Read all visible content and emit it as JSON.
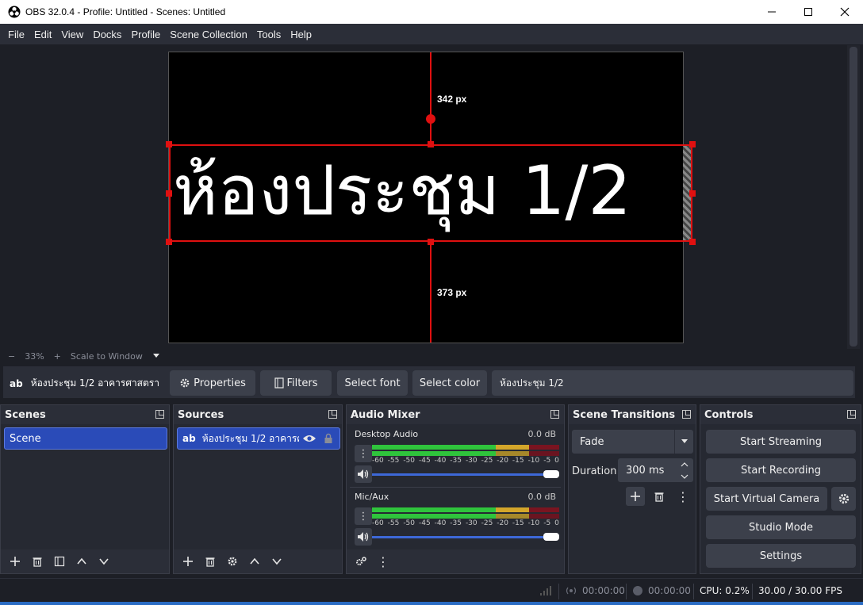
{
  "window": {
    "title": "OBS 32.0.4 - Profile: Untitled - Scenes: Untitled"
  },
  "menu": [
    "File",
    "Edit",
    "View",
    "Docks",
    "Profile",
    "Scene Collection",
    "Tools",
    "Help"
  ],
  "preview": {
    "text": "ห้องประชุม 1/2",
    "top_distance": "342 px",
    "bottom_distance": "373 px"
  },
  "zoom": {
    "minus": "−",
    "level": "33%",
    "plus": "+",
    "mode": "Scale to Window"
  },
  "source_toolbar": {
    "source_name": "ห้องประชุม 1/2 อาคารศาสตรา",
    "properties": "Properties",
    "filters": "Filters",
    "select_font": "Select font",
    "select_color": "Select color",
    "text_value": "ห้องประชุม 1/2"
  },
  "scenes": {
    "title": "Scenes",
    "items": [
      "Scene"
    ]
  },
  "sources": {
    "title": "Sources",
    "items": [
      "ห้องประชุม 1/2 อาคารศ"
    ]
  },
  "audio_mixer": {
    "title": "Audio Mixer",
    "ticks": [
      "-60",
      "-55",
      "-50",
      "-45",
      "-40",
      "-35",
      "-30",
      "-25",
      "-20",
      "-15",
      "-10",
      "-5",
      "0"
    ],
    "channels": [
      {
        "name": "Desktop Audio",
        "db": "0.0 dB",
        "volume": 1.0
      },
      {
        "name": "Mic/Aux",
        "db": "0.0 dB",
        "volume": 1.0
      }
    ]
  },
  "transitions": {
    "title": "Scene Transitions",
    "selected": "Fade",
    "duration_label": "Duration",
    "duration_value": "300 ms"
  },
  "controls": {
    "title": "Controls",
    "start_streaming": "Start Streaming",
    "start_recording": "Start Recording",
    "start_virtual_camera": "Start Virtual Camera",
    "studio_mode": "Studio Mode",
    "settings": "Settings"
  },
  "status": {
    "stream_time": "00:00:00",
    "record_time": "00:00:00",
    "cpu": "CPU: 0.2%",
    "fps": "30.00 / 30.00 FPS"
  },
  "colors": {
    "accent": "#2a4bb8",
    "selection": "#e01010",
    "background": "#1d1f26",
    "panel": "#262932"
  }
}
